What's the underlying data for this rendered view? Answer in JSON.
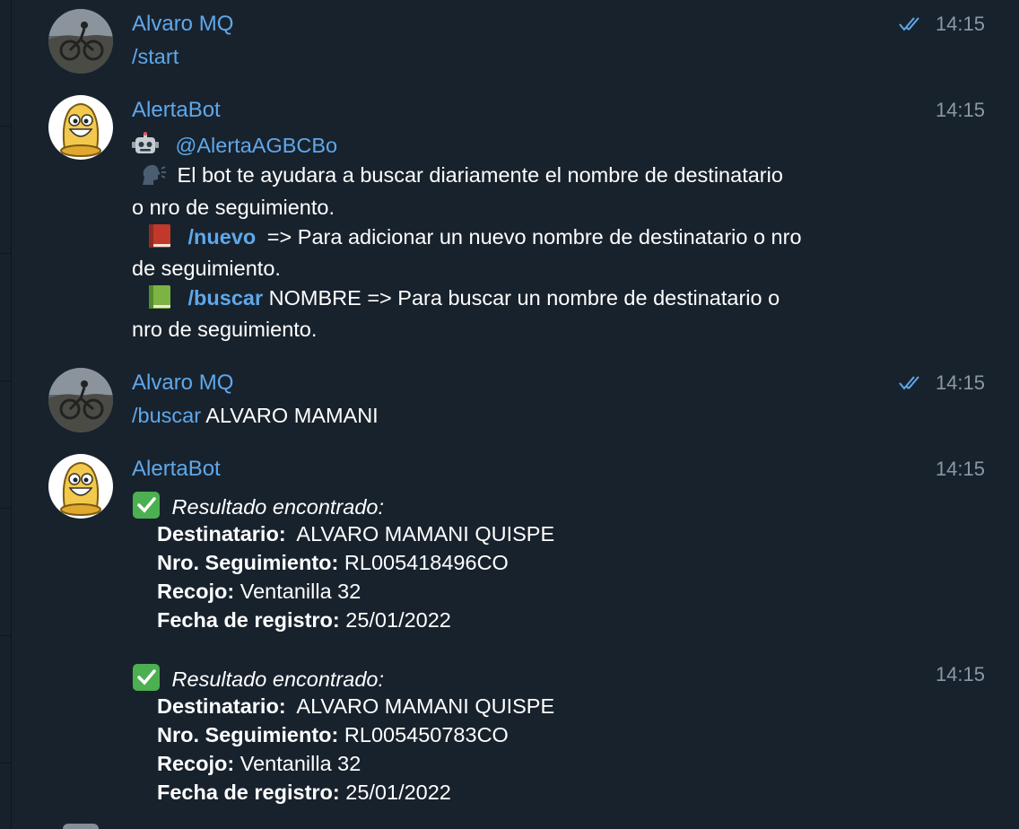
{
  "messages": [
    {
      "sender": "Alvaro MQ",
      "time": "14:15",
      "text_cmd": "/start"
    },
    {
      "sender": "AlertaBot",
      "time": "14:15",
      "handle": "@AlertaAGBCBo",
      "line1": "El bot te ayudara a buscar diariamente el nombre de destinatario",
      "line2": "o nro de seguimiento.",
      "nuevo_cmd": "/nuevo",
      "nuevo_text": " => Para adicionar un nuevo nombre de destinatario o nro",
      "nuevo_text2": "de seguimiento.",
      "buscar_cmd": "/buscar",
      "buscar_text": " NOMBRE => Para buscar un nombre de destinatario o",
      "buscar_text2": "nro de seguimiento."
    },
    {
      "sender": "Alvaro MQ",
      "time": "14:15",
      "cmd": "/buscar",
      "arg": " ALVARO MAMANI"
    },
    {
      "sender": "AlertaBot",
      "time": "14:15",
      "results": [
        {
          "heading": "Resultado encontrado:",
          "dest_label": "Destinatario:",
          "dest_value": "  ALVARO MAMANI QUISPE",
          "seg_label": "Nro. Seguimiento:",
          "seg_value": " RL005418496CO",
          "recojo_label": "Recojo:",
          "recojo_value": " Ventanilla 32",
          "fecha_label": "Fecha de registro:",
          "fecha_value": " 25/01/2022"
        },
        {
          "time": "14:15",
          "heading": "Resultado encontrado:",
          "dest_label": "Destinatario:",
          "dest_value": "  ALVARO MAMANI QUISPE",
          "seg_label": "Nro. Seguimiento:",
          "seg_value": " RL005450783CO",
          "recojo_label": "Recojo:",
          "recojo_value": " Ventanilla 32",
          "fecha_label": "Fecha de registro:",
          "fecha_value": " 25/01/2022"
        }
      ]
    }
  ],
  "colors": {
    "background": "#18222d",
    "link": "#5fa8ea",
    "time": "#8a98a6",
    "check": "#5fa8ea"
  },
  "icons": [
    "user-avatar-icon",
    "bot-avatar-icon",
    "double-check-icon",
    "robot-emoji-icon",
    "speaking-head-icon",
    "red-book-icon",
    "green-book-icon",
    "check-mark-icon"
  ]
}
